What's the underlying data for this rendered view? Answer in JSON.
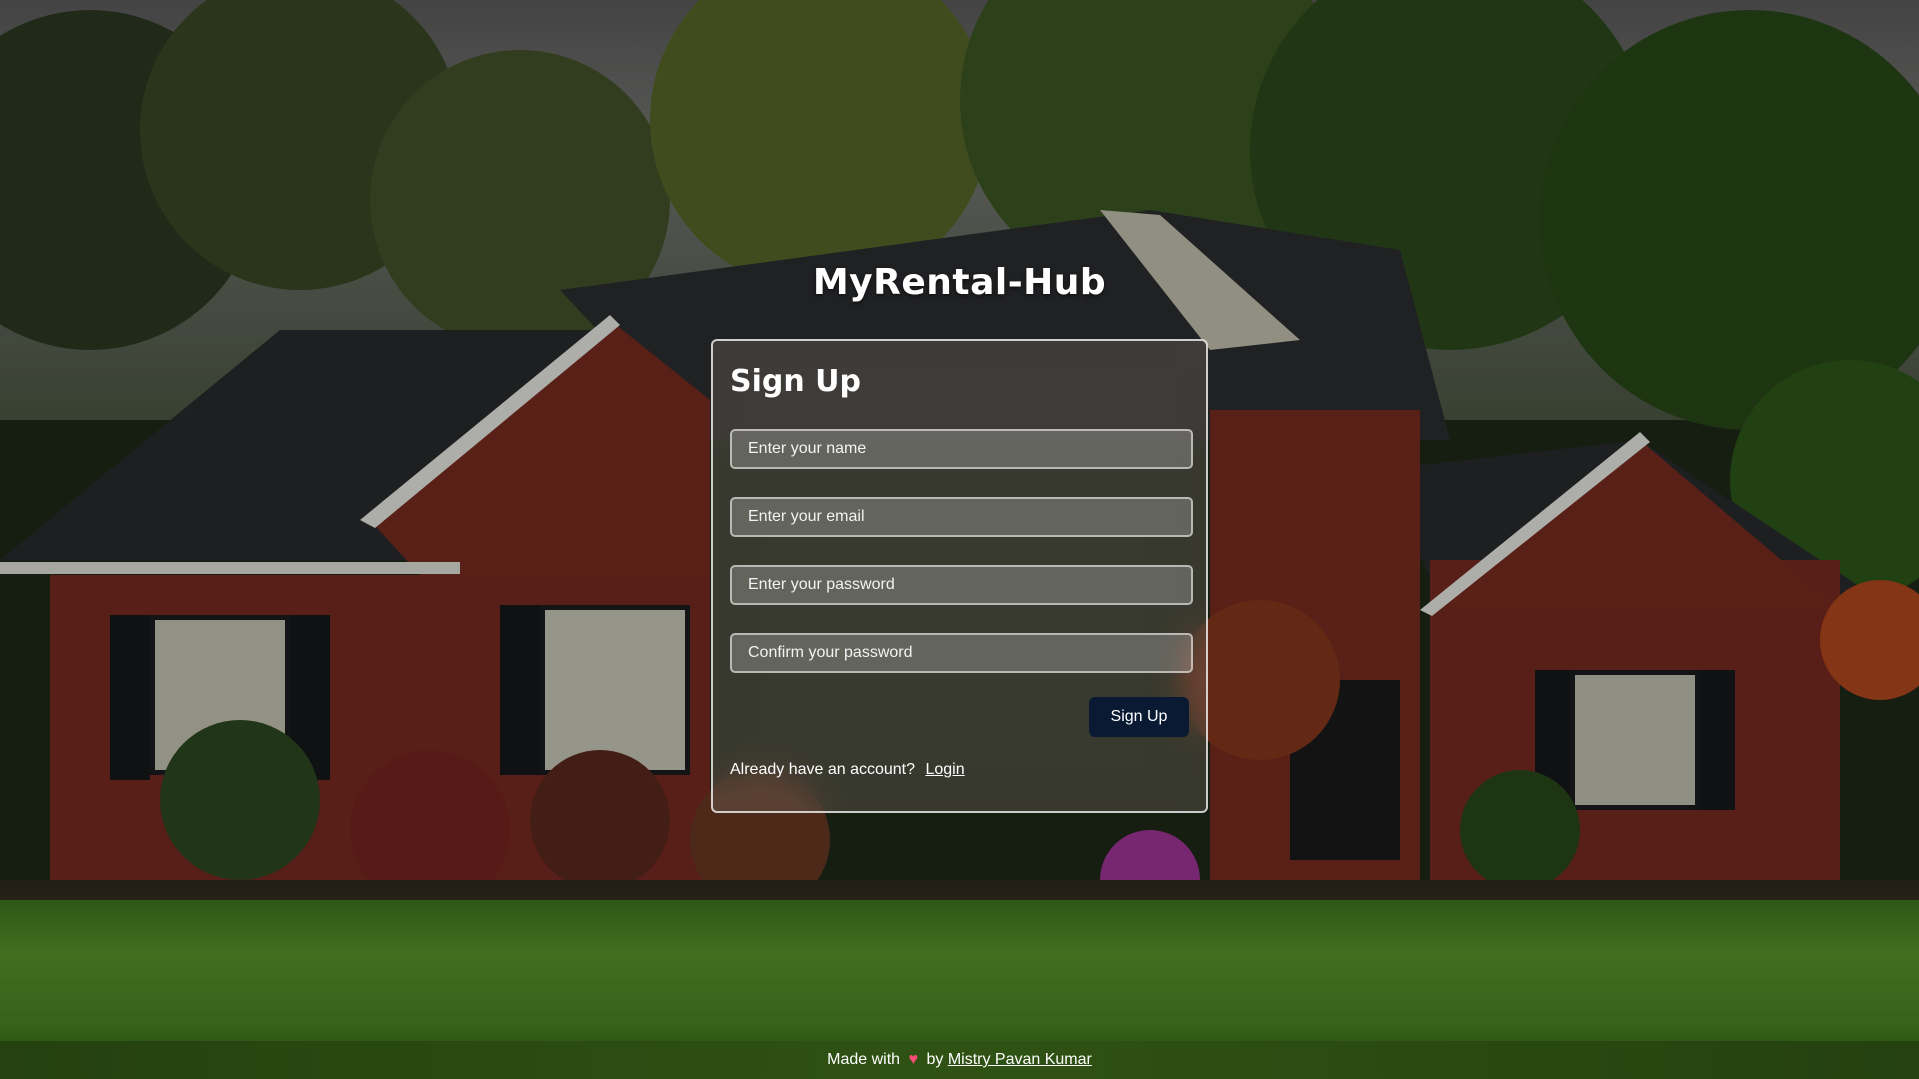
{
  "app": {
    "title": "MyRental-Hub"
  },
  "signup": {
    "heading": "Sign Up",
    "fields": {
      "name_placeholder": "Enter your name",
      "email_placeholder": "Enter your email",
      "password_placeholder": "Enter your password",
      "confirm_placeholder": "Confirm your password"
    },
    "submit_label": "Sign Up",
    "switch_prompt": "Already have an account?",
    "switch_link": "Login"
  },
  "footer": {
    "made_with": "Made with",
    "heart_icon": "heart-icon",
    "by": "by",
    "author": "Mistry Pavan Kumar"
  },
  "colors": {
    "button_bg": "#0b1a33",
    "heart": "#ff4d7a"
  }
}
